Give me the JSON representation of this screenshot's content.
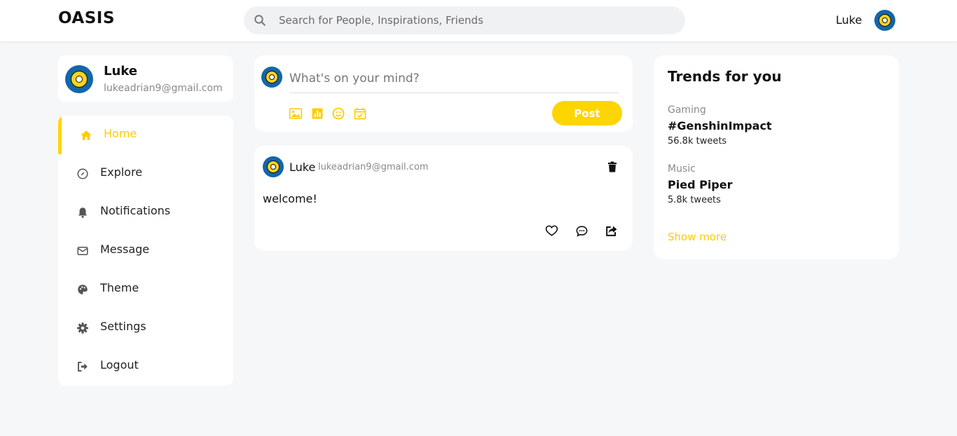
{
  "app": {
    "logo": "OASIS"
  },
  "search": {
    "placeholder": "Search for People, Inspirations, Friends"
  },
  "topbar": {
    "user_name": "Luke"
  },
  "profile": {
    "name": "Luke",
    "email": "lukeadrian9@gmail.com"
  },
  "nav": {
    "items": [
      {
        "label": "Home",
        "icon": "home-icon",
        "active": true
      },
      {
        "label": "Explore",
        "icon": "compass-icon"
      },
      {
        "label": "Notifications",
        "icon": "bell-icon"
      },
      {
        "label": "Message",
        "icon": "envelope-icon"
      },
      {
        "label": "Theme",
        "icon": "palette-icon"
      },
      {
        "label": "Settings",
        "icon": "gear-icon"
      },
      {
        "label": "Logout",
        "icon": "logout-icon"
      }
    ]
  },
  "composer": {
    "placeholder": "What's on your mind?",
    "post_label": "Post",
    "tools": [
      "image-icon",
      "chart-icon",
      "smile-icon",
      "calendar-icon"
    ]
  },
  "post": {
    "author": "Luke",
    "email": "lukeadrian9@gmail.com",
    "text": "welcome!"
  },
  "trends": {
    "title": "Trends for you",
    "items": [
      {
        "category": "Gaming",
        "name": "#GenshinImpact",
        "count": "56.8k tweets"
      },
      {
        "category": "Music",
        "name": "Pied Piper",
        "count": "5.8k tweets"
      }
    ],
    "show_more": "Show more"
  },
  "colors": {
    "accent": "#ffd500",
    "avatar_bg": "#1466a8",
    "background": "#f6f7f9"
  }
}
